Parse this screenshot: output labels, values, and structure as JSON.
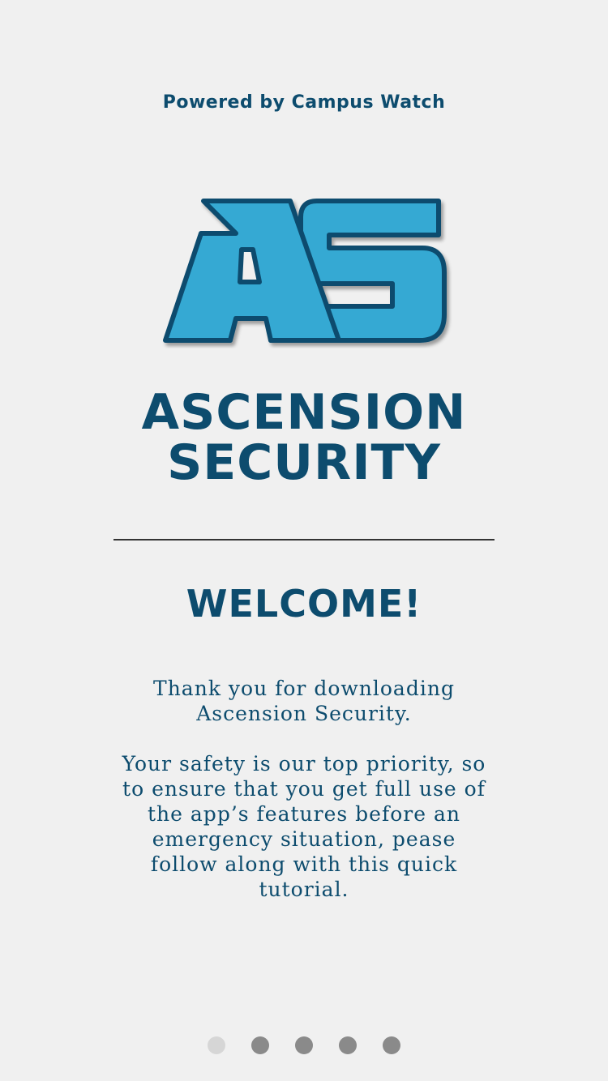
{
  "header": {
    "powered_by": "Powered by Campus Watch"
  },
  "logo": {
    "letters": "AS",
    "fill_color": "#34a9d3",
    "outline_color": "#0d4c6e"
  },
  "brand": {
    "line1": "ASCENSION",
    "line2": "SECURITY"
  },
  "welcome": {
    "title": "WELCOME!",
    "paragraph1": "Thank you for downloading Ascension Security.",
    "paragraph2": "Your safety is our top priority, so to ensure that you get full use of the app’s features before an emergency situation, pease follow along with this quick tutorial."
  },
  "pagination": {
    "total": 5,
    "current": 1
  },
  "colors": {
    "background": "#f0f0f0",
    "brand_navy": "#0d4c6e",
    "divider": "#333333",
    "dot_active": "#d6d6d6",
    "dot_inactive": "#8a8a8a"
  }
}
